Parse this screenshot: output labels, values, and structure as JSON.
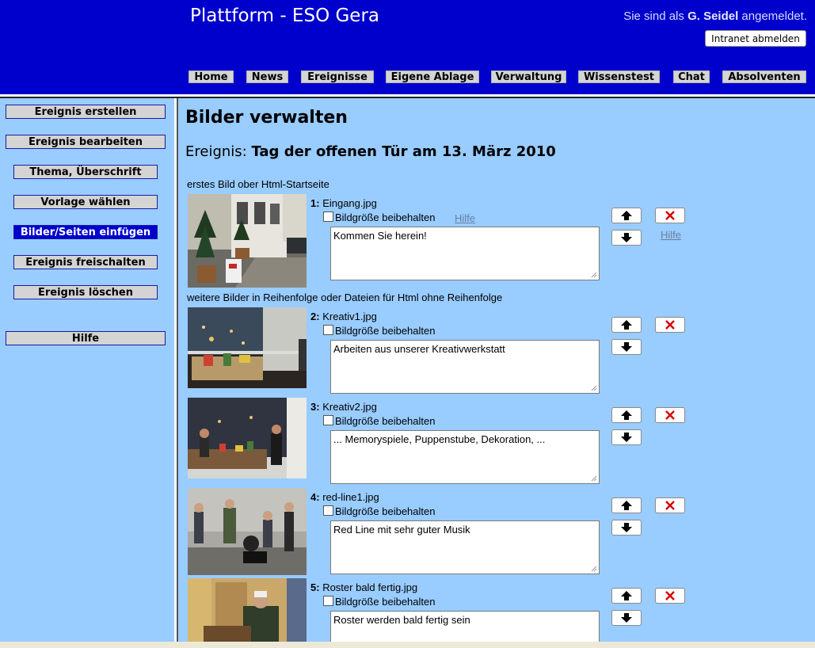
{
  "header": {
    "site_title": "Plattform - ESO Gera",
    "login_prefix": "Sie sind als ",
    "login_user": "G. Seidel",
    "login_suffix": " angemeldet.",
    "logout_label": "Intranet abmelden",
    "nav": [
      "Home",
      "News",
      "Ereignisse",
      "Eigene Ablage",
      "Verwaltung",
      "Wissenstest",
      "Chat",
      "Absolventen"
    ]
  },
  "sidebar": {
    "items": [
      {
        "label": "Ereignis erstellen",
        "active": false
      },
      {
        "label": "Ereignis bearbeiten",
        "active": false
      },
      {
        "label": "Thema, Überschrift",
        "active": false
      },
      {
        "label": "Vorlage wählen",
        "active": false
      },
      {
        "label": "Bilder/Seiten einfügen",
        "active": true
      },
      {
        "label": "Ereignis freischalten",
        "active": false
      },
      {
        "label": "Ereignis löschen",
        "active": false
      },
      {
        "label": "Hilfe",
        "active": false
      }
    ]
  },
  "main": {
    "heading": "Bilder verwalten",
    "event_prefix": "Ereignis: ",
    "event_name": "Tag der offenen Tür am 13. März 2010",
    "first_section_label": "erstes Bild ober Html-Startseite",
    "more_section_label": "weitere Bilder in Reihenfolge oder Dateien für Html ohne Reihenfolge",
    "keep_size_label": "Bildgröße beibehalten",
    "help_label": "Hilfe",
    "images": [
      {
        "num": "1:",
        "file": "Eingang.jpg",
        "caption": "Kommen Sie herein!"
      },
      {
        "num": "2:",
        "file": "Kreativ1.jpg",
        "caption": "Arbeiten aus unserer Kreativwerkstatt"
      },
      {
        "num": "3:",
        "file": "Kreativ2.jpg",
        "caption": "... Memoryspiele, Puppenstube, Dekoration, ..."
      },
      {
        "num": "4:",
        "file": "red-line1.jpg",
        "caption": "Red Line mit sehr guter Musik"
      },
      {
        "num": "5:",
        "file": "Roster bald fertig.jpg",
        "caption": "Roster werden bald fertig sein"
      }
    ]
  },
  "colors": {
    "header_bg": "#0000cc",
    "content_bg": "#99ccff",
    "delete_x": "#d40000"
  },
  "icons": {
    "up": "arrow-up-icon",
    "down": "arrow-down-icon",
    "delete": "delete-x-icon"
  }
}
